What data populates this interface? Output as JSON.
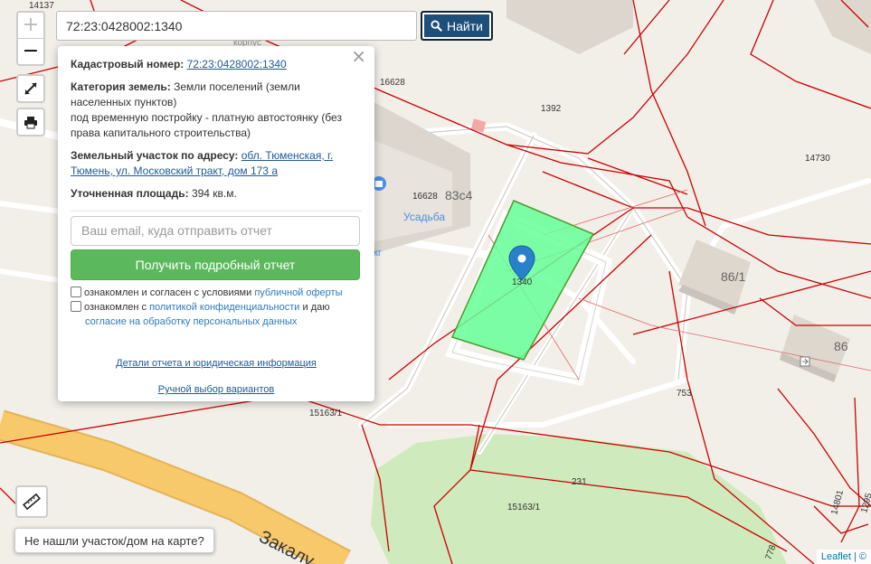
{
  "search": {
    "value": "72:23:0428002:1340",
    "button_label": "Найти"
  },
  "zoom": {
    "in_label": "+",
    "out_label": "−"
  },
  "map": {
    "parcel_labels": {
      "l14137": "14137",
      "l16628a": "16628",
      "l16628b": "16628",
      "l1392": "1392",
      "l14730": "14730",
      "l753": "753",
      "l15163a": "15163/1",
      "l15163b": "15163/1",
      "l231": "231",
      "l14801": "14801",
      "l1295": "1295",
      "l778": "778"
    },
    "building_labels": {
      "b83c4": "83с4",
      "b86_1": "86/1",
      "b86": "86"
    },
    "poi_usadba": "Усадьба",
    "poi_partial_kg": "кг",
    "poi_partial_korpus": "корпус",
    "street_name": "Закалу",
    "marker_label": "1340",
    "colors": {
      "parcel_border": "#cc0000",
      "selected_fill": "#66ff99",
      "selected_border": "#4a9a2a",
      "marker": "#2a81cb",
      "road_major": "#f8c96a"
    }
  },
  "popup": {
    "cadastral_label": "Кадастровый номер:",
    "cadastral_value": "72:23:0428002:1340",
    "category_label": "Категория земель:",
    "category_value": "Земли поселений (земли населенных пунктов)",
    "usage_value": "под временную постройку - платную автостоянку (без права капитального строительства)",
    "address_label": "Земельный участок по адресу:",
    "address_value": "обл. Тюменская, г. Тюмень, ул. Московский тракт, дом 173 а",
    "area_label": "Уточненная площадь:",
    "area_value": "394 кв.м.",
    "email_placeholder": "Ваш email, куда отправить отчет",
    "get_report_button": "Получить подробный отчет",
    "consent1_text": "ознакомлен и согласен с условиями ",
    "consent1_link": "публичной оферты",
    "consent2_text": "ознакомлен с ",
    "consent2_link": "политикой конфиденциальности",
    "consent2_text2": " и даю",
    "consent2_link2": "согласие на обработку персональных данных",
    "details_link": "Детали отчета и юридическая информация",
    "manual_link": "Ручной выбор вариантов",
    "close_label": "×"
  },
  "not_found_button": "Не нашли участок/дом на карте?",
  "attribution": "Leaflet | ©"
}
